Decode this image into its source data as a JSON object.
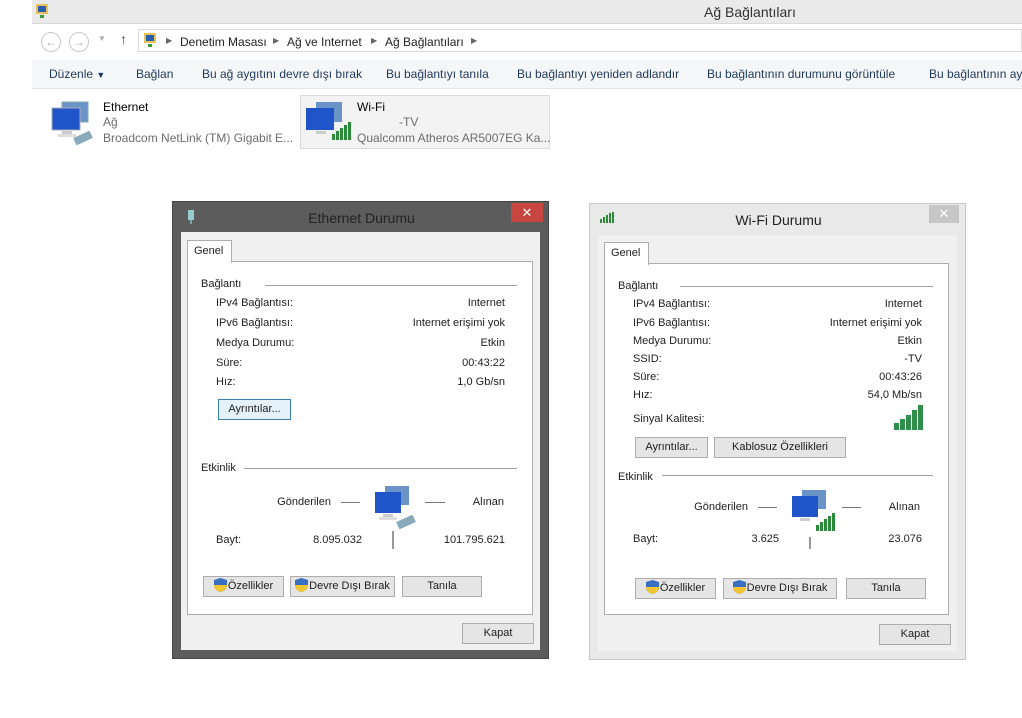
{
  "window": {
    "title": "Ağ Bağlantıları"
  },
  "breadcrumb": [
    "Denetim Masası",
    "Ağ ve Internet",
    "Ağ Bağlantıları"
  ],
  "toolbar": [
    "Düzenle",
    "Bağlan",
    "Bu ağ aygıtını devre dışı bırak",
    "Bu bağlantıyı tanıla",
    "Bu bağlantıyı yeniden adlandır",
    "Bu bağlantının durumunu görüntüle",
    "Bu bağlantının ay"
  ],
  "connections": [
    {
      "name": "Ethernet",
      "status": "Ağ",
      "device": "Broadcom NetLink (TM) Gigabit E..."
    },
    {
      "name": "Wi-Fi",
      "status": "-TV",
      "device": "Qualcomm Atheros AR5007EG Ka..."
    }
  ],
  "ethernet": {
    "title": "Ethernet Durumu",
    "tab": "Genel",
    "connection_header": "Bağlantı",
    "rows": [
      {
        "k": "IPv4 Bağlantısı:",
        "v": "Internet"
      },
      {
        "k": "IPv6 Bağlantısı:",
        "v": "Internet erişimi yok"
      },
      {
        "k": "Medya Durumu:",
        "v": "Etkin"
      },
      {
        "k": "Süre:",
        "v": "00:43:22"
      },
      {
        "k": "Hız:",
        "v": "1,0 Gb/sn"
      }
    ],
    "details": "Ayrıntılar...",
    "activity_header": "Etkinlik",
    "sent": "Gönderilen",
    "received": "Alınan",
    "bytes_label": "Bayt:",
    "bytes_sent": "8.095.032",
    "bytes_received": "101.795.621",
    "properties": "Özellikler",
    "disable": "Devre Dışı Bırak",
    "diagnose": "Tanıla",
    "close": "Kapat"
  },
  "wifi": {
    "title": "Wi-Fi Durumu",
    "tab": "Genel",
    "connection_header": "Bağlantı",
    "rows": [
      {
        "k": "IPv4 Bağlantısı:",
        "v": "Internet"
      },
      {
        "k": "IPv6 Bağlantısı:",
        "v": "Internet erişimi yok"
      },
      {
        "k": "Medya Durumu:",
        "v": "Etkin"
      },
      {
        "k": "SSID:",
        "v": "-TV"
      },
      {
        "k": "Süre:",
        "v": "00:43:26"
      },
      {
        "k": "Hız:",
        "v": "54,0 Mb/sn"
      }
    ],
    "signal_label": "Sinyal Kalitesi:",
    "signal_bars": 5,
    "details": "Ayrıntılar...",
    "wireless_props": "Kablosuz Özellikleri",
    "activity_header": "Etkinlik",
    "sent": "Gönderilen",
    "received": "Alınan",
    "bytes_label": "Bayt:",
    "bytes_sent": "3.625",
    "bytes_received": "23.076",
    "properties": "Özellikler",
    "disable": "Devre Dışı Bırak",
    "diagnose": "Tanıla",
    "close": "Kapat"
  }
}
